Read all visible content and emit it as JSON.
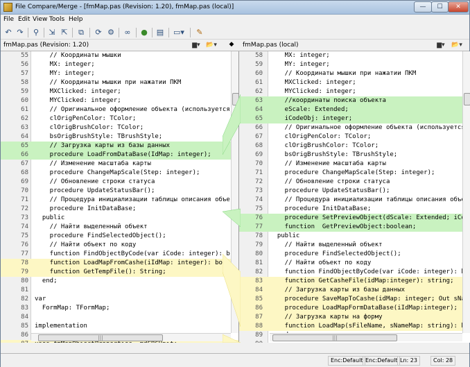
{
  "window": {
    "title": "File Compare/Merge - [fmMap.pas (Revision: 1.20), fmMap.pas (local)]",
    "controls": [
      "minimize",
      "maximize",
      "close"
    ]
  },
  "menu": [
    "File",
    "Edit",
    "View",
    "Tools",
    "Help"
  ],
  "toolbar": {
    "icons": [
      "undo-icon",
      "redo-icon",
      "find-icon",
      "next-diff-icon",
      "prev-diff-icon",
      "copy-icon",
      "refresh-icon",
      "options-icon",
      "link-icon",
      "merge-icon",
      "document-icon",
      "view-mode-icon",
      "edit-icon"
    ]
  },
  "files": {
    "left_name": "fmMap.pas (Revision: 1.20)",
    "right_name": "fmMap.pas (local)",
    "swap_label": "◆"
  },
  "left_lines": [
    {
      "n": "55",
      "t": "    // Координаты мышки",
      "hl": ""
    },
    {
      "n": "56",
      "t": "    MX: integer;",
      "hl": ""
    },
    {
      "n": "57",
      "t": "    MY: integer;",
      "hl": ""
    },
    {
      "n": "58",
      "t": "    // Координаты мышки при нажатии ПКМ",
      "hl": ""
    },
    {
      "n": "59",
      "t": "    MXClicked: integer;",
      "hl": ""
    },
    {
      "n": "60",
      "t": "    MYClicked: integer;",
      "hl": ""
    },
    {
      "n": "61",
      "t": "    // Оригинальное оформление объекта (используется",
      "hl": ""
    },
    {
      "n": "62",
      "t": "    clOrigPenColor: TColor;",
      "hl": ""
    },
    {
      "n": "63",
      "t": "    clOrigBrushColor: TColor;",
      "hl": ""
    },
    {
      "n": "64",
      "t": "    bsOrigBrushStyle: TBrushStyle;",
      "hl": ""
    },
    {
      "n": "65",
      "t": "    // Загрузка карты из базы данных",
      "hl": "green"
    },
    {
      "n": "66",
      "t": "    procedure LoadFromDataBase(IdMap: integer);",
      "hl": "green"
    },
    {
      "n": "67",
      "t": "    // Изменение масштаба карты",
      "hl": ""
    },
    {
      "n": "68",
      "t": "    procedure ChangeMapScale(Step: integer);",
      "hl": ""
    },
    {
      "n": "69",
      "t": "    // Обновление строки статуса",
      "hl": ""
    },
    {
      "n": "70",
      "t": "    procedure UpdateStatusBar();",
      "hl": ""
    },
    {
      "n": "71",
      "t": "    // Процедура инициализации таблицы описания объе",
      "hl": ""
    },
    {
      "n": "72",
      "t": "    procedure InitDataBase;",
      "hl": ""
    },
    {
      "n": "73",
      "t": "  public",
      "hl": ""
    },
    {
      "n": "74",
      "t": "    // Найти выделенный объект",
      "hl": ""
    },
    {
      "n": "75",
      "t": "    procedure FindSelectedObject();",
      "hl": ""
    },
    {
      "n": "76",
      "t": "    // Найти объект по коду",
      "hl": ""
    },
    {
      "n": "77",
      "t": "    function FindObjectByCode(var iCode: integer): b",
      "hl": ""
    },
    {
      "n": "78",
      "t": "    function LoadMapFromCashe(iIdMap: integer): bool",
      "hl": "yellow"
    },
    {
      "n": "79",
      "t": "    function GetTempFile(): String;",
      "hl": "yellow"
    },
    {
      "n": "80",
      "t": "  end;",
      "hl": ""
    },
    {
      "n": "81",
      "t": "",
      "hl": ""
    },
    {
      "n": "82",
      "t": "var",
      "hl": ""
    },
    {
      "n": "83",
      "t": "  FormMap: TFormMap;",
      "hl": ""
    },
    {
      "n": "84",
      "t": "",
      "hl": ""
    },
    {
      "n": "85",
      "t": "implementation",
      "hl": ""
    },
    {
      "n": "86",
      "t": "",
      "hl": ""
    },
    {
      "n": "87",
      "t": "uses fmMapObjectProperties, mdCRCUnit;",
      "hl": "yellow"
    }
  ],
  "right_lines": [
    {
      "n": "58",
      "t": "    MX: integer;",
      "hl": ""
    },
    {
      "n": "59",
      "t": "    MY: integer;",
      "hl": ""
    },
    {
      "n": "60",
      "t": "    // Координаты мышки при нажатии ПКМ",
      "hl": ""
    },
    {
      "n": "61",
      "t": "    MXClicked: integer;",
      "hl": ""
    },
    {
      "n": "62",
      "t": "    MYClicked: integer;",
      "hl": ""
    },
    {
      "n": "63",
      "t": "    //координаты поиска объекта",
      "hl": "green"
    },
    {
      "n": "64",
      "t": "    eScale: Extended;",
      "hl": "green"
    },
    {
      "n": "65",
      "t": "    iCodeObj: integer;",
      "hl": "green"
    },
    {
      "n": "66",
      "t": "    // Оригинальное оформление объекта (используется .",
      "hl": ""
    },
    {
      "n": "67",
      "t": "    clOrigPenColor: TColor;",
      "hl": ""
    },
    {
      "n": "68",
      "t": "    clOrigBrushColor: TColor;",
      "hl": ""
    },
    {
      "n": "69",
      "t": "    bsOrigBrushStyle: TBrushStyle;",
      "hl": ""
    },
    {
      "n": "70",
      "t": "    // Изменение масштаба карты",
      "hl": ""
    },
    {
      "n": "71",
      "t": "    procedure ChangeMapScale(Step: integer);",
      "hl": ""
    },
    {
      "n": "72",
      "t": "    // Обновление строки статуса",
      "hl": ""
    },
    {
      "n": "73",
      "t": "    procedure UpdateStatusBar();",
      "hl": ""
    },
    {
      "n": "74",
      "t": "    // Процедура инициализации таблицы описания объек",
      "hl": ""
    },
    {
      "n": "75",
      "t": "    procedure InitDataBase;",
      "hl": ""
    },
    {
      "n": "76",
      "t": "    procedure SetPreviewObject(dScale: Extended; iCod",
      "hl": "green"
    },
    {
      "n": "77",
      "t": "    function  GetPreviewObject:boolean;",
      "hl": "green"
    },
    {
      "n": "78",
      "t": "  public",
      "hl": ""
    },
    {
      "n": "79",
      "t": "    // Найти выделенный объект",
      "hl": ""
    },
    {
      "n": "80",
      "t": "    procedure FindSelectedObject();",
      "hl": ""
    },
    {
      "n": "81",
      "t": "    // Найти объект по коду",
      "hl": ""
    },
    {
      "n": "82",
      "t": "    function FindObjectByCode(var iCode: integer): bo",
      "hl": ""
    },
    {
      "n": "83",
      "t": "    function GetCasheFile(idMap:integer): string;",
      "hl": "yellow"
    },
    {
      "n": "84",
      "t": "    // Загрузка карты из базы данных",
      "hl": "yellow"
    },
    {
      "n": "85",
      "t": "    procedure SaveMapToCashe(idMap: integer; Out sNa",
      "hl": "yellow"
    },
    {
      "n": "86",
      "t": "    procedure LoadMapFormDataBase(iIdMap:integer);",
      "hl": "yellow"
    },
    {
      "n": "87",
      "t": "    // Загрузка карты на форму",
      "hl": "yellow"
    },
    {
      "n": "88",
      "t": "    function LoadMap(sFileName, sNameMap: string): bo",
      "hl": "yellow"
    },
    {
      "n": "89",
      "t": "  end;",
      "hl": ""
    },
    {
      "n": "90",
      "t": "",
      "hl": ""
    },
    {
      "n": "91",
      "t": "",
      "hl": ""
    }
  ],
  "status": {
    "enc_left": "Enc:Default",
    "enc_right": "Enc:Default",
    "line": "Ln: 23",
    "col": "Col: 28"
  },
  "colors": {
    "added": "#c9f2c0",
    "changed": "#fdf7c4",
    "connector_green": "#7fd77a",
    "connector_yellow": "#e9dd7a"
  }
}
